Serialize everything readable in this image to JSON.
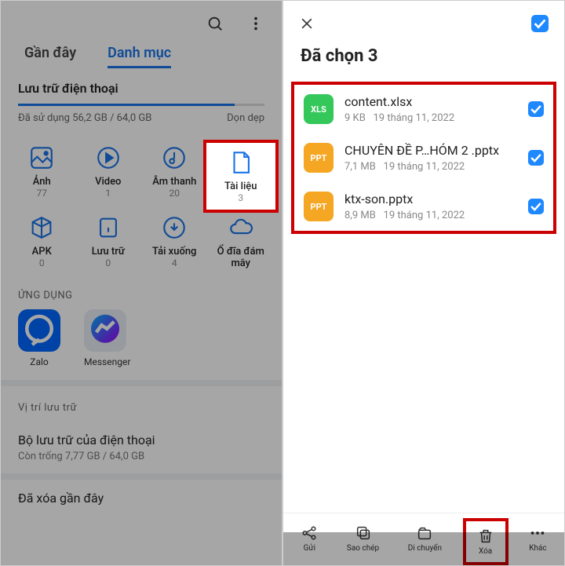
{
  "left": {
    "tab_recent": "Gần đây",
    "tab_categories": "Danh mục",
    "storage_title": "Lưu trữ điện thoại",
    "storage_used": "Đã sử dụng 56,2 GB / 64,0 GB",
    "cleanup": "Dọn dẹp",
    "tiles": [
      {
        "label": "Ảnh",
        "count": "77"
      },
      {
        "label": "Video",
        "count": "1"
      },
      {
        "label": "Âm thanh",
        "count": "20"
      },
      {
        "label": "Tài liệu",
        "count": "3"
      },
      {
        "label": "APK",
        "count": "0"
      },
      {
        "label": "Lưu trữ",
        "count": "0"
      },
      {
        "label": "Tải xuống",
        "count": "4"
      },
      {
        "label": "Ổ đĩa đám mây",
        "count": ""
      }
    ],
    "apps_label": "ỨNG DỤNG",
    "apps": [
      {
        "name": "Zalo"
      },
      {
        "name": "Messenger"
      }
    ],
    "storage_section": "Vị trí lưu trữ",
    "phone_storage": "Bộ lưu trữ của điện thoại",
    "phone_storage_sub": "Còn trống 7,77 GB / 64,0 GB",
    "recent_deleted": "Đã xóa gần đây"
  },
  "right": {
    "title": "Đã chọn 3",
    "files": [
      {
        "type": "XLS",
        "name": "content.xlsx",
        "size": "9 KB",
        "date": "19 tháng 11, 2022"
      },
      {
        "type": "PPT",
        "name": "CHUYÊN ĐỀ P…HÓM 2 .pptx",
        "size": "7,1 MB",
        "date": "19 tháng 11, 2022"
      },
      {
        "type": "PPT",
        "name": "ktx-son.pptx",
        "size": "8,9 MB",
        "date": "19 tháng 11, 2022"
      }
    ],
    "actions": {
      "send": "Gửi",
      "copy": "Sao chép",
      "move": "Di chuyển",
      "delete": "Xóa",
      "more": "Khác"
    }
  }
}
